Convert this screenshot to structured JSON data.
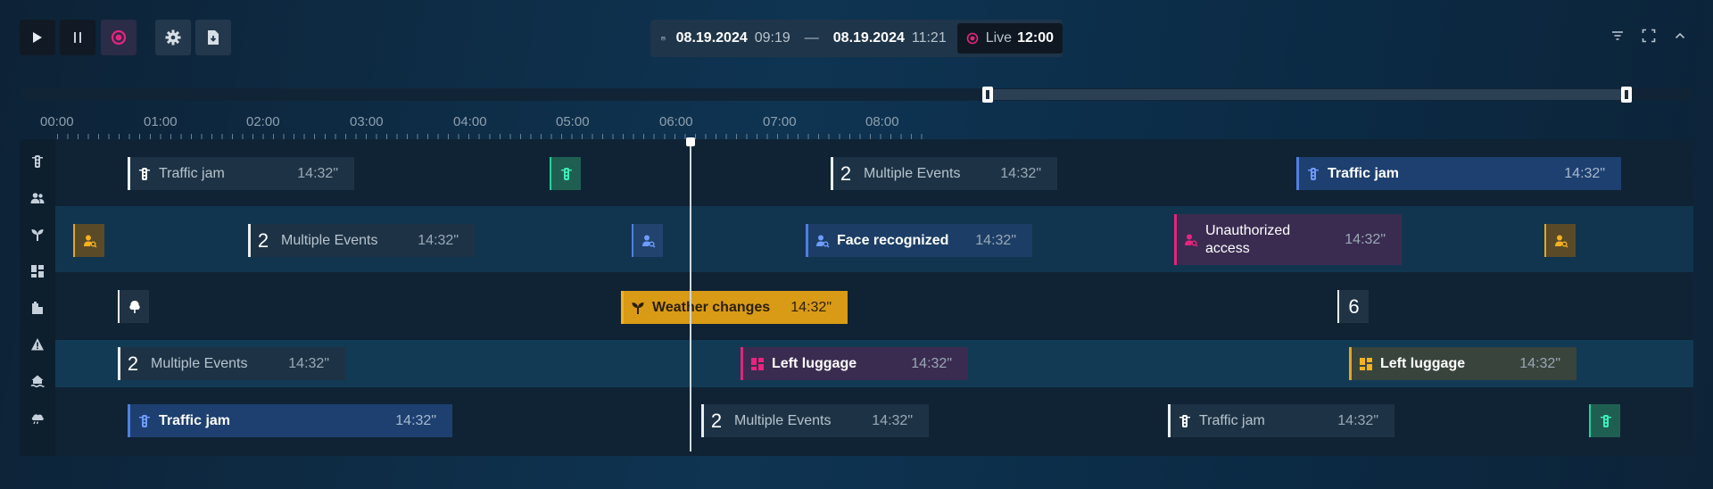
{
  "toolbar": {
    "start_date": "08.19.2024",
    "start_time": "09:19",
    "separator": "—",
    "end_date": "08.19.2024",
    "end_time": "11:21",
    "live_label": "Live",
    "live_time": "12:00"
  },
  "ruler": {
    "labels": [
      "00:00",
      "01:00",
      "02:00",
      "03:00",
      "04:00",
      "05:00",
      "06:00",
      "07:00",
      "08:00"
    ]
  },
  "rows": {
    "r1": {
      "e1": {
        "name": "Traffic jam",
        "duration": "14:32\""
      },
      "e2": {
        "count": "2",
        "name": "Multiple Events",
        "duration": "14:32\""
      },
      "e3": {
        "name": "Traffic jam",
        "duration": "14:32\""
      }
    },
    "r2": {
      "e1": {
        "count": "2",
        "name": "Multiple Events",
        "duration": "14:32\""
      },
      "e2": {
        "name": "Face recognized",
        "duration": "14:32\""
      },
      "e3": {
        "name": "Unauthorized access",
        "duration": "14:32\""
      }
    },
    "r3": {
      "e1": {
        "name": "Weather changes",
        "duration": "14:32\""
      },
      "e2": {
        "count": "6"
      }
    },
    "r4": {
      "e1": {
        "count": "2",
        "name": "Multiple Events",
        "duration": "14:32\""
      },
      "e2": {
        "name": "Left luggage",
        "duration": "14:32\""
      },
      "e3": {
        "name": "Left luggage",
        "duration": "14:32\""
      }
    },
    "r5": {
      "e1": {
        "name": "Traffic jam",
        "duration": "14:32\""
      },
      "e2": {
        "count": "2",
        "name": "Multiple Events",
        "duration": "14:32\""
      },
      "e3": {
        "name": "Traffic jam",
        "duration": "14:32\""
      }
    }
  },
  "colors": {
    "accent_record": "#e8247f",
    "traffic_green": "#20d39a",
    "event_blue": "#4f7fe0",
    "alert_pink": "#e0257a",
    "warning_amber": "#f3b21e"
  }
}
